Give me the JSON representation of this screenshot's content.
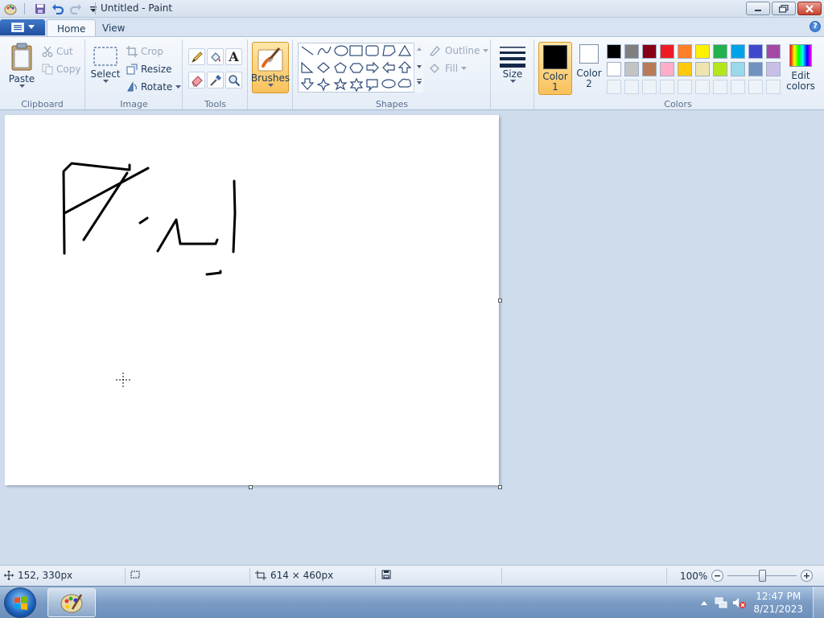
{
  "window": {
    "title": "Untitled - Paint"
  },
  "tabs": {
    "home": "Home",
    "view": "View"
  },
  "clipboard": {
    "paste": "Paste",
    "cut": "Cut",
    "copy": "Copy",
    "group": "Clipboard"
  },
  "image": {
    "select": "Select",
    "crop": "Crop",
    "resize": "Resize",
    "rotate": "Rotate",
    "group": "Image"
  },
  "tools": {
    "group": "Tools",
    "text_tool_glyph": "A"
  },
  "brushes": {
    "label": "Brushes"
  },
  "shapes": {
    "outline": "Outline",
    "fill": "Fill",
    "group": "Shapes"
  },
  "size": {
    "label": "Size"
  },
  "colors": {
    "color1_label": "Color",
    "color1_num": "1",
    "color2_label": "Color",
    "color2_num": "2",
    "edit_label": "Edit",
    "edit_label2": "colors",
    "group": "Colors",
    "color1": "#000000",
    "color2": "#ffffff",
    "palette_row1": [
      "#000000",
      "#7f7f7f",
      "#880015",
      "#ed1c24",
      "#ff7f27",
      "#fff200",
      "#22b14c",
      "#00a2e8",
      "#3f48cc",
      "#a349a4"
    ],
    "palette_row2": [
      "#ffffff",
      "#c3c3c3",
      "#b97a57",
      "#ffaec9",
      "#ffc90e",
      "#efe4b0",
      "#b5e61d",
      "#99d9ea",
      "#7092be",
      "#c8bfe7"
    ]
  },
  "status": {
    "cursor_pos": "152, 330px",
    "canvas_size": "614 × 460px",
    "zoom": "100%",
    "zoom_level": 0.5
  },
  "taskbar": {
    "time": "12:47 PM",
    "date": "8/21/2023"
  }
}
